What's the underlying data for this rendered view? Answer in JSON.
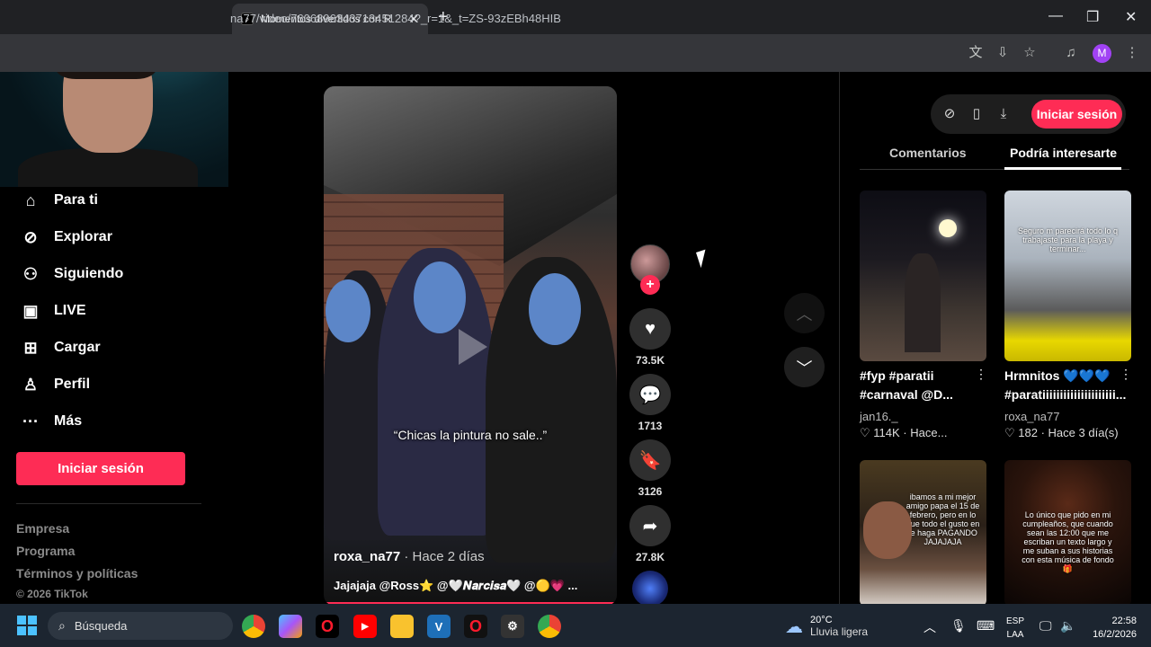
{
  "browser": {
    "tab_title": "Momentos divertidos con R",
    "tab_favicon": "tiktok-icon",
    "new_tab": "+",
    "url": "na77/video/7606896343713451284?_r=1&_t=ZS-93zEBh48HIB",
    "profile_initial": "M",
    "window_controls": {
      "minimize": "—",
      "restore": "❐",
      "close": "✕"
    },
    "toolbar_icons": [
      "translate-icon",
      "install-app-icon",
      "star-icon",
      "media-icon"
    ]
  },
  "sidebar": {
    "items": [
      {
        "label": "Para ti",
        "icon": "home-icon"
      },
      {
        "label": "Explorar",
        "icon": "compass-icon"
      },
      {
        "label": "Siguiendo",
        "icon": "following-icon"
      },
      {
        "label": "LIVE",
        "icon": "live-icon"
      },
      {
        "label": "Cargar",
        "icon": "upload-icon"
      },
      {
        "label": "Perfil",
        "icon": "profile-icon"
      },
      {
        "label": "Más",
        "icon": "more-icon"
      }
    ],
    "login_label": "Iniciar sesión",
    "footer_links": [
      "Empresa",
      "Programa",
      "Términos y políticas"
    ],
    "copyright": "© 2026 TikTok"
  },
  "video": {
    "caption_overlay": "“Chicas la pintura no sale..”",
    "author": "roxa_na77",
    "time": " · Hace 2 días",
    "description": "Jajajaja @Ross⭐ @🤍𝑵𝒂𝒓𝒄𝒊𝒔𝒂🤍 @🟡💗 ...",
    "likes": "73.5K",
    "comments": "1713",
    "saves": "3126",
    "shares": "27.8K",
    "follow_label": "+"
  },
  "right_panel": {
    "login_label": "Iniciar sesión",
    "tabs": [
      "Comentarios",
      "Podría interesarte"
    ],
    "active_tab": "Podría interesarte",
    "cards": [
      {
        "title": "#fyp #paratii #carnaval @D...",
        "author": "jan16._",
        "likes": "114K",
        "time": "Hace..."
      },
      {
        "title": "Hrmnitos 💙💙💙 #paratiiiiiiiiiiiiiiiiiiiii...",
        "author": "roxa_na77",
        "likes": "182",
        "time": "Hace 3 día(s)",
        "overlay": "Seguro m parecirá todo lo q trabajaste para la playa y terminar..."
      },
      {
        "overlay": "ibamos a mi mejor amigo papa el 15 de febrero, pero en lo que todo el gusto en te haga PAGANDO JAJAJAJA"
      },
      {
        "overlay": "Lo único que pido en mi cumpleaños, que cuando sean las 12:00 que me escriban un texto largo y me suban a sus historias con esta música de fondo 🎁"
      }
    ]
  },
  "taskbar": {
    "search_placeholder": "Búsqueda",
    "weather_temp": "20°C",
    "weather_desc": "Lluvia ligera",
    "lang_line1": "ESP",
    "lang_line2": "LAA",
    "time": "22:58",
    "date": "16/2/2026",
    "apps": [
      "chrome-icon",
      "copilot-icon",
      "opera-icon",
      "youtube-icon",
      "file-explorer-icon",
      "v-app-icon",
      "opera-gx-icon",
      "settings-icon",
      "chrome-profile-icon"
    ]
  },
  "colors": {
    "accent": "#fe2c55",
    "background": "#000000",
    "taskbar": "#1c2530",
    "browser_chrome": "#202124"
  }
}
